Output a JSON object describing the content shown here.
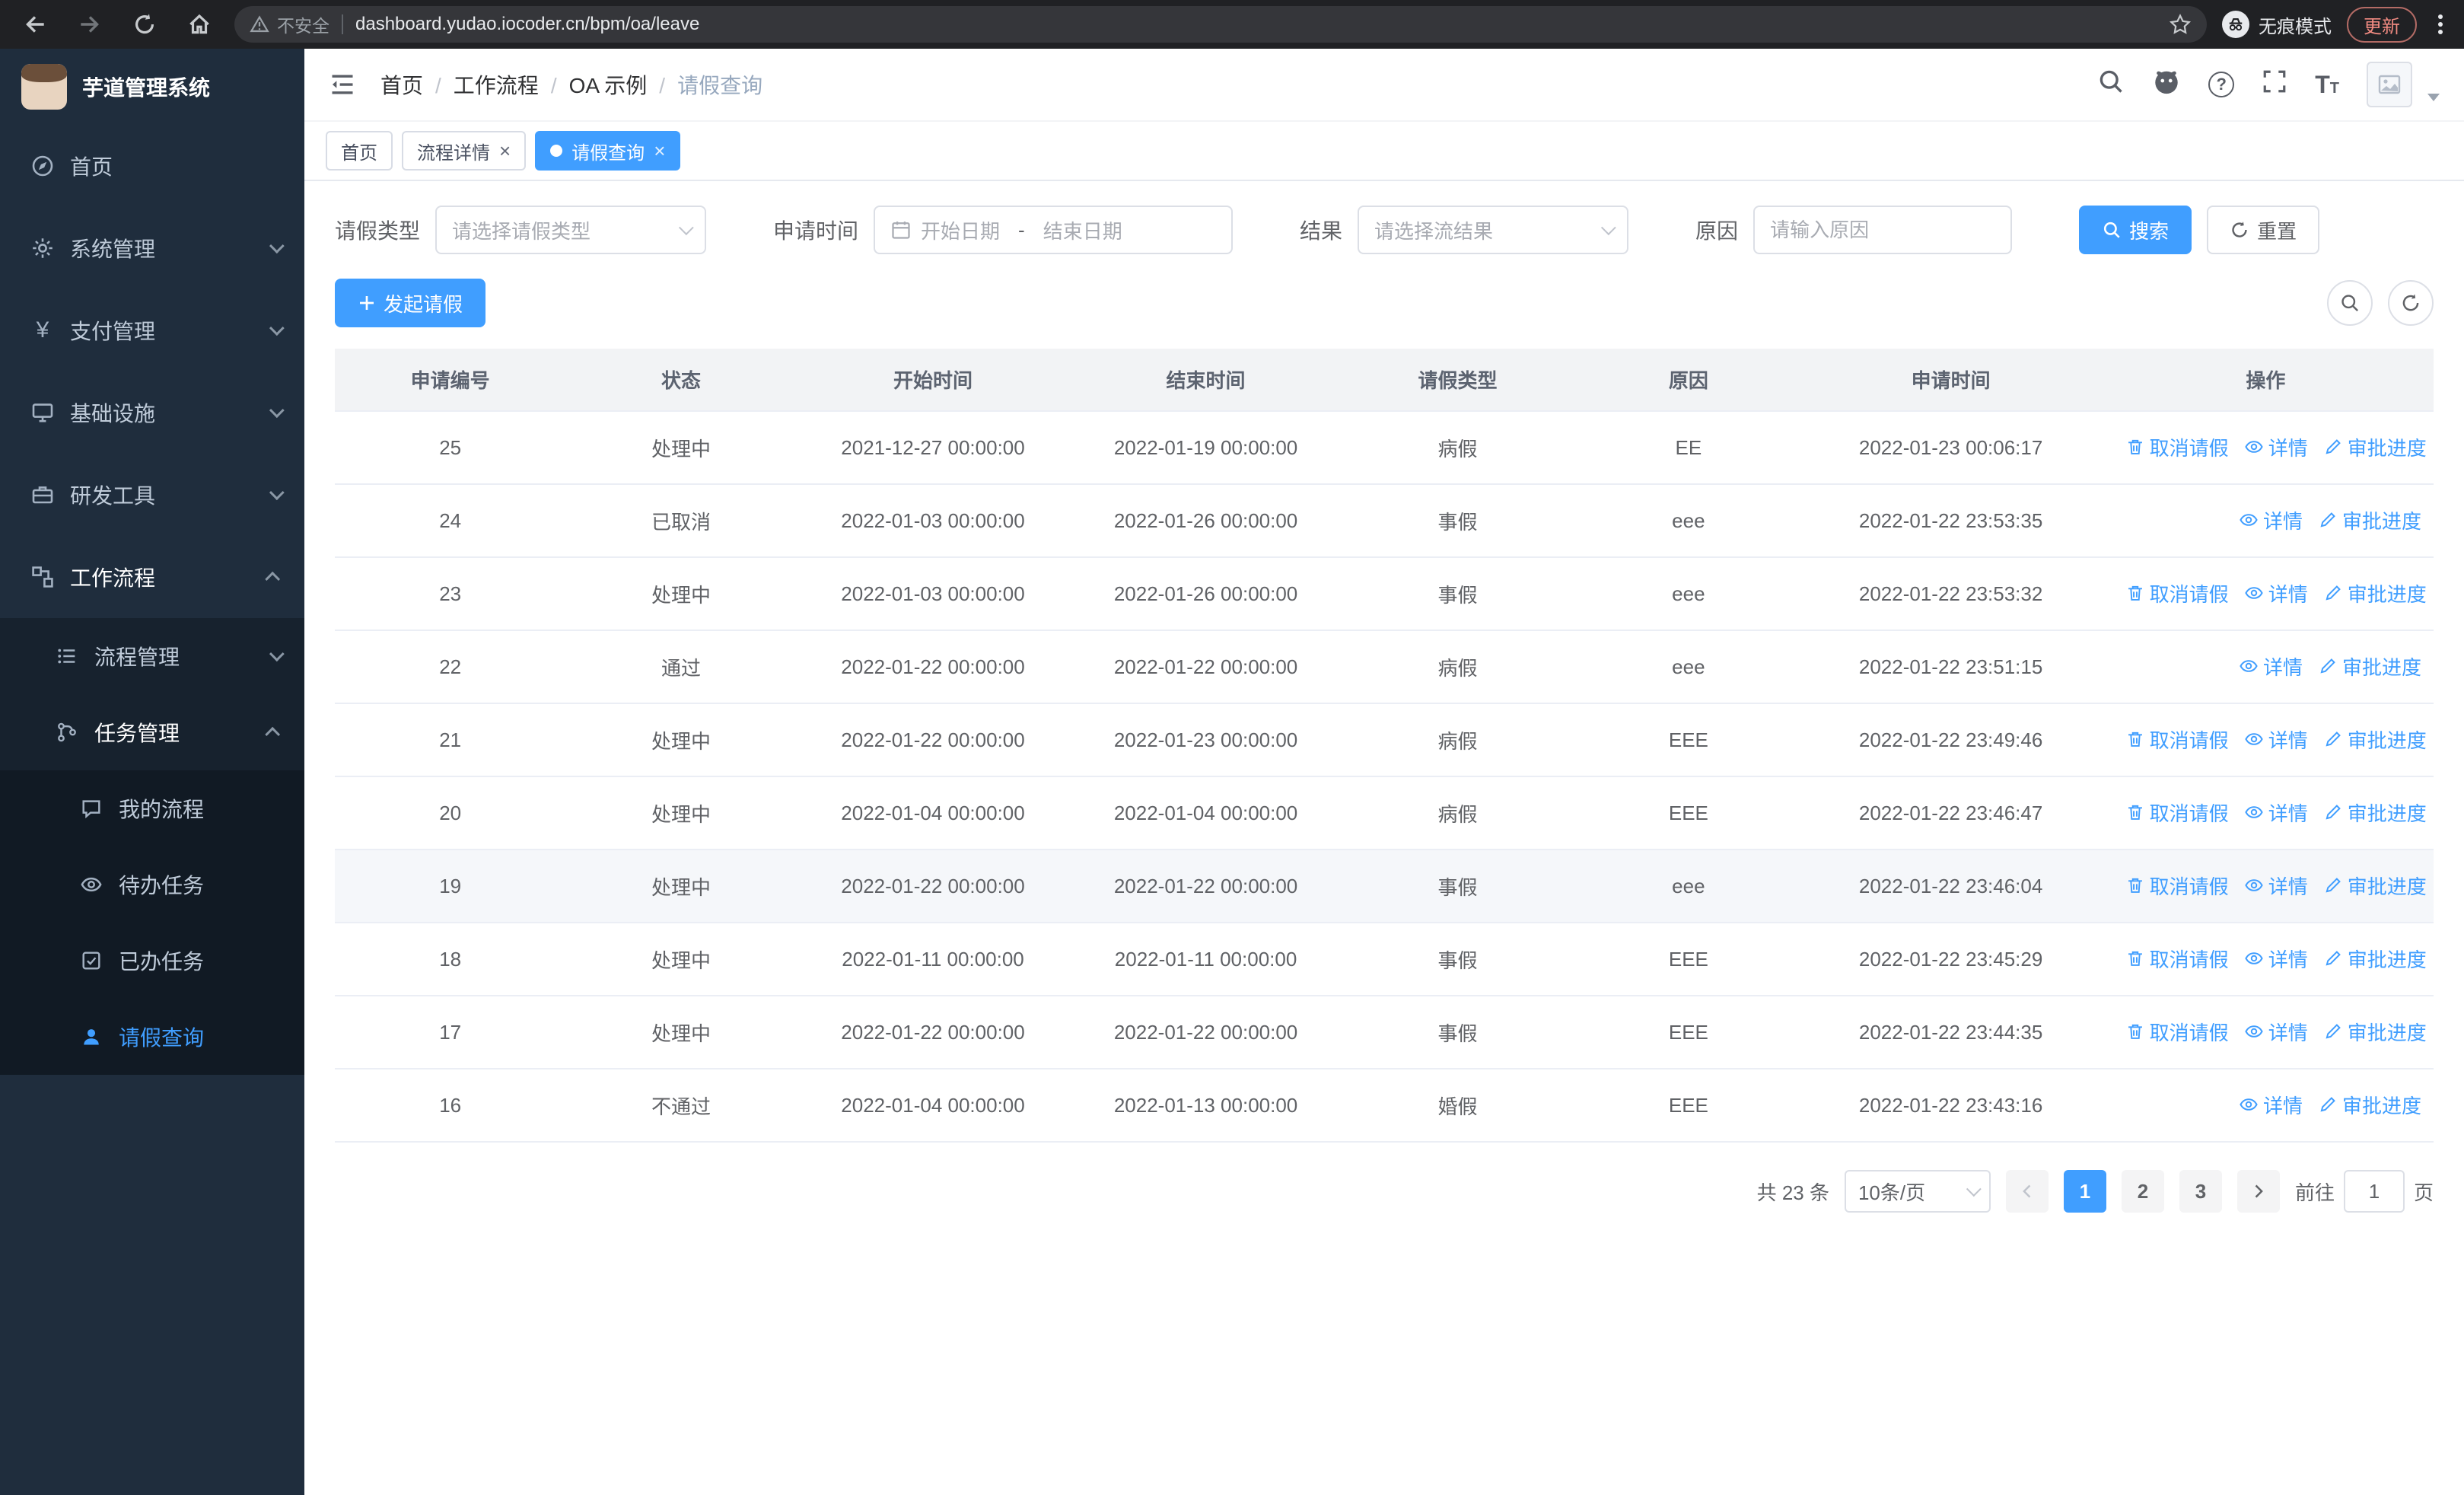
{
  "browser": {
    "security_label": "不安全",
    "url": "dashboard.yudao.iocoder.cn/bpm/oa/leave",
    "incognito_label": "无痕模式",
    "update_label": "更新"
  },
  "ui": {
    "close_symbol": "×",
    "question_glyph": "?",
    "font_icon_glyph": "T",
    "yen_glyph": "¥"
  },
  "colors": {
    "primary": "#409eff",
    "sidebar_bg": "#1f2d3d"
  },
  "sidebar": {
    "app_title": "芋道管理系统",
    "items": [
      {
        "label": "首页"
      },
      {
        "label": "系统管理"
      },
      {
        "label": "支付管理"
      },
      {
        "label": "基础设施"
      },
      {
        "label": "研发工具"
      },
      {
        "label": "工作流程"
      }
    ],
    "workflow_children": [
      {
        "label": "流程管理"
      },
      {
        "label": "任务管理"
      }
    ],
    "task_children": [
      {
        "label": "我的流程"
      },
      {
        "label": "待办任务"
      },
      {
        "label": "已办任务"
      },
      {
        "label": "请假查询"
      }
    ]
  },
  "navbar": {
    "breadcrumb": [
      "首页",
      "工作流程",
      "OA 示例",
      "请假查询"
    ]
  },
  "tags": [
    {
      "label": "首页",
      "closable": false,
      "active": false
    },
    {
      "label": "流程详情",
      "closable": true,
      "active": false
    },
    {
      "label": "请假查询",
      "closable": true,
      "active": true
    }
  ],
  "filters": {
    "leave_type_label": "请假类型",
    "leave_type_placeholder": "请选择请假类型",
    "apply_time_label": "申请时间",
    "start_date_placeholder": "开始日期",
    "date_separator": "-",
    "end_date_placeholder": "结束日期",
    "result_label": "结果",
    "result_placeholder": "请选择流结果",
    "reason_label": "原因",
    "reason_placeholder": "请输入原因",
    "search_button": "搜索",
    "reset_button": "重置"
  },
  "toolbar": {
    "create_label": "发起请假"
  },
  "table": {
    "columns": [
      "申请编号",
      "状态",
      "开始时间",
      "结束时间",
      "请假类型",
      "原因",
      "申请时间",
      "操作"
    ],
    "action_labels": {
      "cancel": "取消请假",
      "detail": "详情",
      "progress": "审批进度"
    },
    "rows": [
      {
        "id": "25",
        "status": "处理中",
        "start": "2021-12-27 00:00:00",
        "end": "2022-01-19 00:00:00",
        "type": "病假",
        "reason": "EE",
        "apply_time": "2022-01-23 00:06:17",
        "actions": [
          "cancel",
          "detail",
          "progress"
        ],
        "highlighted": false
      },
      {
        "id": "24",
        "status": "已取消",
        "start": "2022-01-03 00:00:00",
        "end": "2022-01-26 00:00:00",
        "type": "事假",
        "reason": "eee",
        "apply_time": "2022-01-22 23:53:35",
        "actions": [
          "detail",
          "progress"
        ],
        "highlighted": false
      },
      {
        "id": "23",
        "status": "处理中",
        "start": "2022-01-03 00:00:00",
        "end": "2022-01-26 00:00:00",
        "type": "事假",
        "reason": "eee",
        "apply_time": "2022-01-22 23:53:32",
        "actions": [
          "cancel",
          "detail",
          "progress"
        ],
        "highlighted": false
      },
      {
        "id": "22",
        "status": "通过",
        "start": "2022-01-22 00:00:00",
        "end": "2022-01-22 00:00:00",
        "type": "病假",
        "reason": "eee",
        "apply_time": "2022-01-22 23:51:15",
        "actions": [
          "detail",
          "progress"
        ],
        "highlighted": false
      },
      {
        "id": "21",
        "status": "处理中",
        "start": "2022-01-22 00:00:00",
        "end": "2022-01-23 00:00:00",
        "type": "病假",
        "reason": "EEE",
        "apply_time": "2022-01-22 23:49:46",
        "actions": [
          "cancel",
          "detail",
          "progress"
        ],
        "highlighted": false
      },
      {
        "id": "20",
        "status": "处理中",
        "start": "2022-01-04 00:00:00",
        "end": "2022-01-04 00:00:00",
        "type": "病假",
        "reason": "EEE",
        "apply_time": "2022-01-22 23:46:47",
        "actions": [
          "cancel",
          "detail",
          "progress"
        ],
        "highlighted": false
      },
      {
        "id": "19",
        "status": "处理中",
        "start": "2022-01-22 00:00:00",
        "end": "2022-01-22 00:00:00",
        "type": "事假",
        "reason": "eee",
        "apply_time": "2022-01-22 23:46:04",
        "actions": [
          "cancel",
          "detail",
          "progress"
        ],
        "highlighted": true
      },
      {
        "id": "18",
        "status": "处理中",
        "start": "2022-01-11 00:00:00",
        "end": "2022-01-11 00:00:00",
        "type": "事假",
        "reason": "EEE",
        "apply_time": "2022-01-22 23:45:29",
        "actions": [
          "cancel",
          "detail",
          "progress"
        ],
        "highlighted": false
      },
      {
        "id": "17",
        "status": "处理中",
        "start": "2022-01-22 00:00:00",
        "end": "2022-01-22 00:00:00",
        "type": "事假",
        "reason": "EEE",
        "apply_time": "2022-01-22 23:44:35",
        "actions": [
          "cancel",
          "detail",
          "progress"
        ],
        "highlighted": false
      },
      {
        "id": "16",
        "status": "不通过",
        "start": "2022-01-04 00:00:00",
        "end": "2022-01-13 00:00:00",
        "type": "婚假",
        "reason": "EEE",
        "apply_time": "2022-01-22 23:43:16",
        "actions": [
          "detail",
          "progress"
        ],
        "highlighted": false
      }
    ]
  },
  "pagination": {
    "total_label": "共 23 条",
    "page_size_label": "10条/页",
    "pages": [
      "1",
      "2",
      "3"
    ],
    "active_page": "1",
    "goto_label": "前往",
    "goto_value": "1",
    "goto_unit": "页"
  }
}
